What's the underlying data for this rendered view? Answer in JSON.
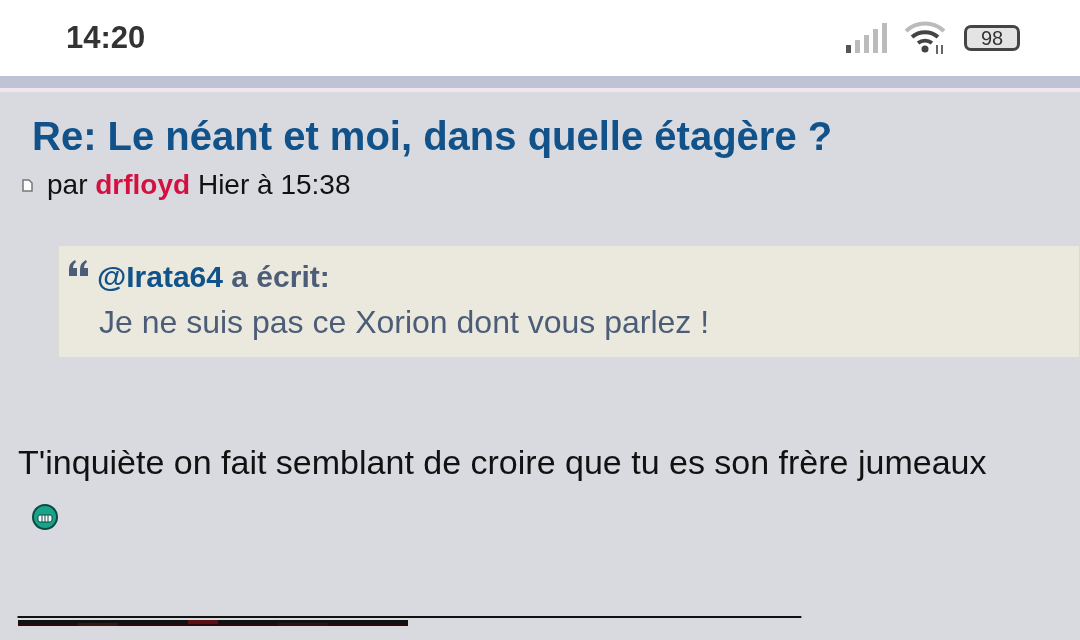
{
  "status_bar": {
    "time": "14:20",
    "battery": "98"
  },
  "post": {
    "title": "Re: Le néant et moi, dans quelle étagère ?",
    "by": "par",
    "author": "drfloyd",
    "date": "Hier à 15:38",
    "quote": {
      "user": "@Irata64",
      "wrote": "a écrit:",
      "text": "Je ne suis pas ce Xorion dont vous parlez !"
    },
    "body": "T'inquiète on fait semblant de croire que tu es son frère jumeaux",
    "signature_rule": "____________________________________________"
  }
}
